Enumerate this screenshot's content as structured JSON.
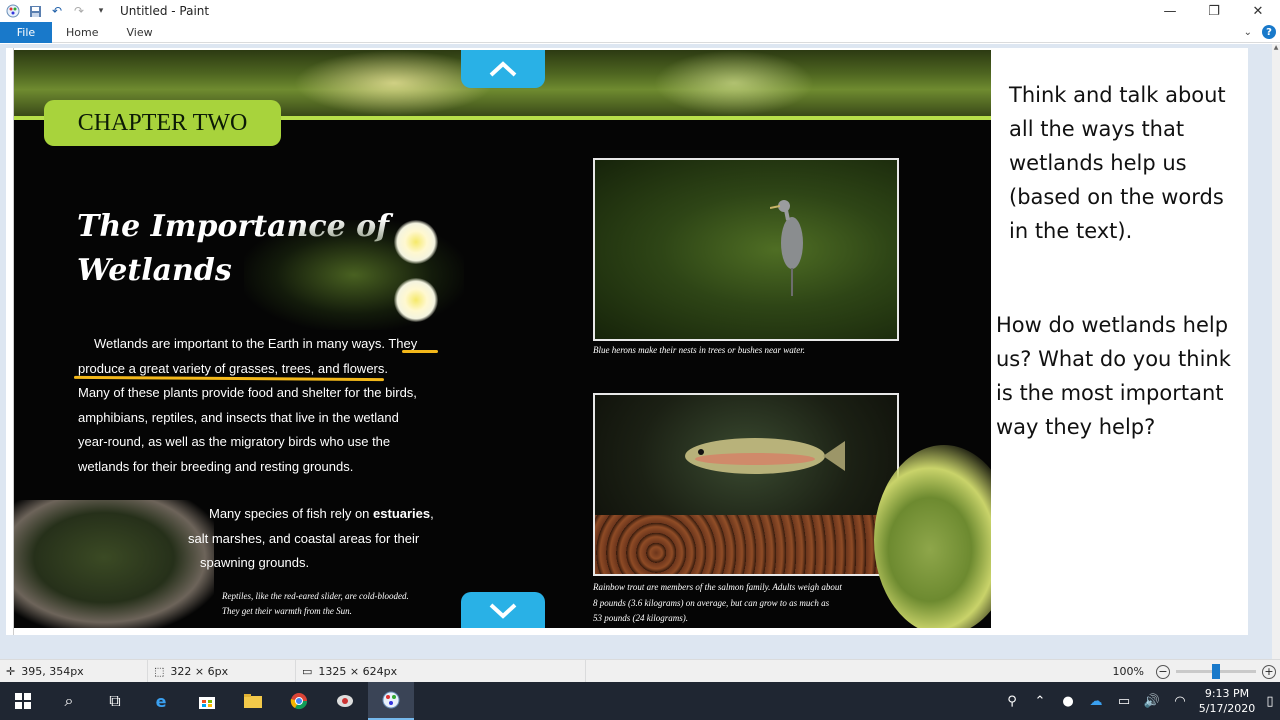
{
  "window": {
    "title": "Untitled - Paint",
    "controls": {
      "minimize": "—",
      "maximize": "❐",
      "close": "✕"
    }
  },
  "ribbon": {
    "tabs": [
      {
        "label": "File"
      },
      {
        "label": "Home"
      },
      {
        "label": "View"
      }
    ],
    "help": "?"
  },
  "slide": {
    "chapter": "CHAPTER TWO",
    "heading_line1": "The Importance of",
    "heading_line2": "Wetlands",
    "paragraph1_a": "Wetlands are important to the Earth in many ways. They",
    "paragraph1_b": "produce a great variety of grasses, trees, and flowers.",
    "paragraph1_c": "Many of these plants provide food and shelter for the birds,",
    "paragraph1_d": "amphibians, reptiles, and insects that live in the wetland",
    "paragraph1_e": "year-round, as well as the migratory birds who use the",
    "paragraph1_f": "wetlands for their breeding and resting grounds.",
    "paragraph2_a_prefix": "Many species of fish rely on ",
    "paragraph2_a_bold": "estuaries",
    "paragraph2_a_suffix": ",",
    "paragraph2_b": "salt marshes, and coastal areas for their",
    "paragraph2_c": "spawning grounds.",
    "turtle_caption_1": "Reptiles, like the red-eared slider, are cold-blooded.",
    "turtle_caption_2": "They get their warmth from the Sun.",
    "heron_caption": "Blue herons make their nests in trees or bushes near water.",
    "trout_caption_1": "Rainbow trout are members of the salmon family. Adults weigh about",
    "trout_caption_2": "8 pounds (3.6 kilograms) on average, but can grow to as much as",
    "trout_caption_3": "53 pounds (24 kilograms)."
  },
  "side_panel": {
    "prompt1": "Think and talk about all the ways that wetlands help us (based on the words in the text).",
    "prompt2": "How do wetlands help us? What do you think is the most important way they help?"
  },
  "statusbar": {
    "cursor_pos": "395, 354px",
    "selection_size": "322 × 6px",
    "image_size": "1325 × 624px",
    "zoom": "100%",
    "zoom_level_fraction": 0.5
  },
  "taskbar": {
    "time": "9:13 PM",
    "date": "5/17/2020"
  },
  "colors": {
    "accent": "#1979ca",
    "chapter_green": "#a8d33c",
    "nav_blue": "#29b1e6",
    "highlight_underline": "#f3b81a"
  }
}
